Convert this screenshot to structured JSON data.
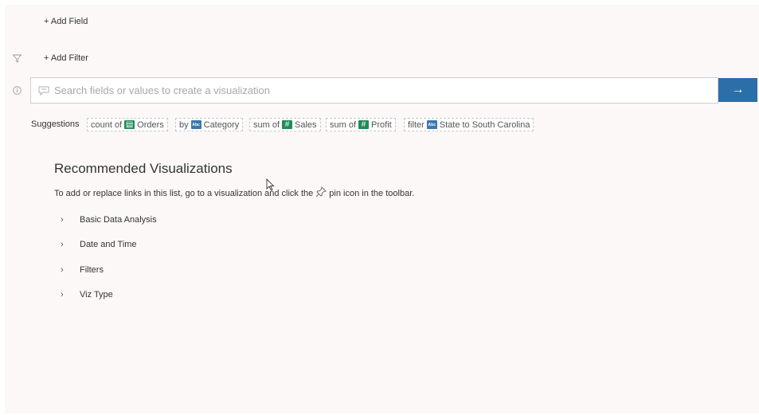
{
  "add_field": "+ Add Field",
  "add_filter": "+ Add Filter",
  "search": {
    "placeholder": "Search fields or values to create a visualization"
  },
  "suggestions": {
    "label": "Suggestions",
    "chips": [
      {
        "prefix": "count of",
        "field": "Orders",
        "suffix": ""
      },
      {
        "prefix": "by",
        "field": "Category",
        "suffix": ""
      },
      {
        "prefix": "sum of",
        "field": "Sales",
        "suffix": ""
      },
      {
        "prefix": "sum of",
        "field": "Profit",
        "suffix": ""
      },
      {
        "prefix": "filter",
        "field": "State",
        "suffix": "to South Carolina"
      }
    ]
  },
  "recommended": {
    "title": "Recommended Visualizations",
    "desc_before": "To add or replace links in this list, go to a visualization and click the",
    "desc_after": "pin icon in the toolbar.",
    "groups": [
      "Basic Data Analysis",
      "Date and Time",
      "Filters",
      "Viz Type"
    ]
  },
  "icons": {
    "filter": "filter-icon",
    "info": "info-icon",
    "search": "speech-bubble-icon",
    "go": "arrow-right-icon",
    "pin": "pin-icon"
  },
  "colors": {
    "accent": "#2b6ea8",
    "measure_icon": "#1f8a5a",
    "dimension_icon": "#3a78ad"
  }
}
